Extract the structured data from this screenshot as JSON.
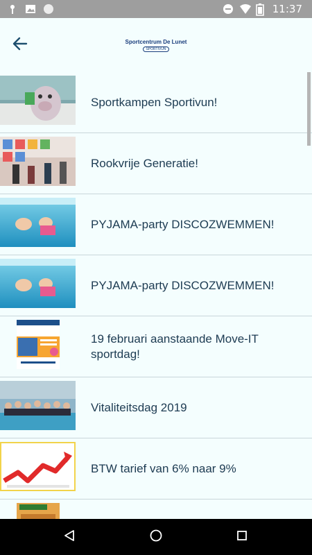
{
  "status_bar": {
    "time": "11:37",
    "icons": [
      "key-icon",
      "image-icon",
      "circle-icon",
      "do-not-disturb-icon",
      "wifi-icon",
      "battery-icon"
    ]
  },
  "app_bar": {
    "back_icon": "arrow-left-icon",
    "logo_text": "Sportcentrum De Lunet",
    "logo_subtext": "SPORTIVUN"
  },
  "news_items": [
    {
      "title": "Sportkampen Sportivun!"
    },
    {
      "title": "Rookvrije Generatie!"
    },
    {
      "title": "PYJAMA-party DISCOZWEMMEN!"
    },
    {
      "title": "PYJAMA-party DISCOZWEMMEN!"
    },
    {
      "title": "19 februari aanstaande Move-IT sportdag!"
    },
    {
      "title": "Vitaliteitsdag 2019"
    },
    {
      "title": "BTW tarief van 6% naar 9%"
    },
    {
      "title": ""
    }
  ],
  "nav_bar": {
    "icons": [
      "back-triangle-icon",
      "home-circle-icon",
      "recents-square-icon"
    ]
  }
}
